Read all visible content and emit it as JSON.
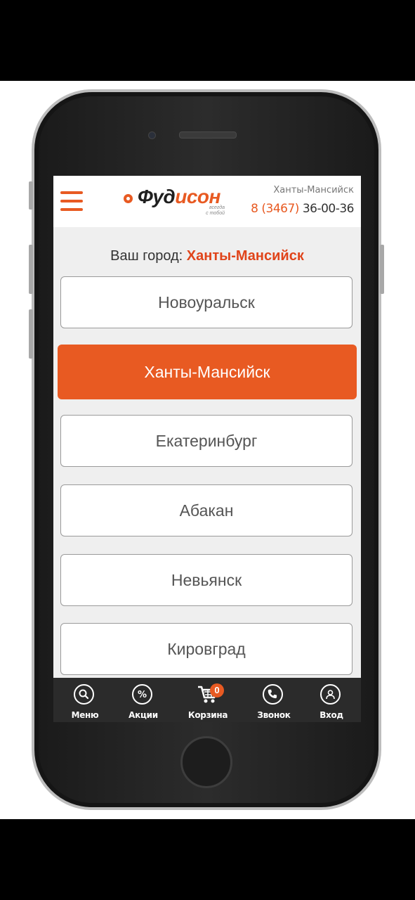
{
  "header": {
    "logo_prefix": "Фуд",
    "logo_accent": "исон",
    "logo_tagline_1": "всегда",
    "logo_tagline_2": "с тобой",
    "city": "Ханты-Мансийск",
    "phone_code": "8 (3467)",
    "phone_number": " 36-00-36"
  },
  "city_select": {
    "label": "Ваш город: ",
    "current": "Ханты-Мансийск",
    "cities": [
      {
        "name": "Новоуральск",
        "selected": false
      },
      {
        "name": "Ханты-Мансийск",
        "selected": true
      },
      {
        "name": "Екатеринбург",
        "selected": false
      },
      {
        "name": "Абакан",
        "selected": false
      },
      {
        "name": "Невьянск",
        "selected": false
      },
      {
        "name": "Кировград",
        "selected": false
      }
    ]
  },
  "bottom_nav": {
    "items": [
      {
        "label": "Меню",
        "icon": "search-icon"
      },
      {
        "label": "Акции",
        "icon": "percent-icon"
      },
      {
        "label": "Корзина",
        "icon": "cart-icon",
        "badge": "0"
      },
      {
        "label": "Звонок",
        "icon": "phone-icon"
      },
      {
        "label": "Вход",
        "icon": "user-icon"
      }
    ]
  },
  "colors": {
    "accent": "#e85a22",
    "bar": "#2b2b2b"
  }
}
